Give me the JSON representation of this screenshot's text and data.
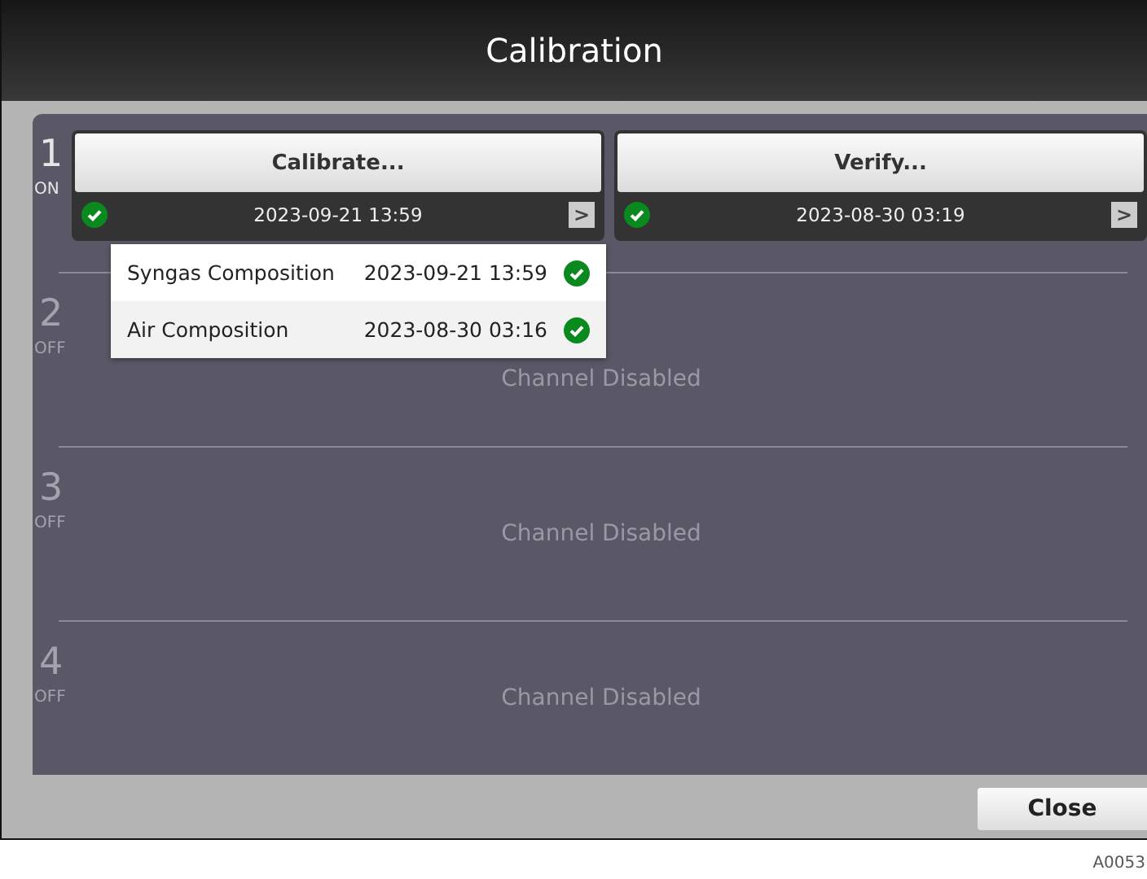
{
  "window": {
    "title": "Calibration"
  },
  "channels": [
    {
      "kind": "active",
      "number": "1",
      "status": "ON",
      "actions": [
        {
          "label": "Calibrate...",
          "date": "2023-09-21 13:59",
          "more": ">",
          "details": [
            {
              "name": "Syngas Composition",
              "date": "2023-09-21 13:59"
            },
            {
              "name": "Air Composition",
              "date": "2023-08-30 03:16"
            }
          ]
        },
        {
          "label": "Verify...",
          "date": "2023-08-30 03:19",
          "more": ">"
        }
      ]
    },
    {
      "kind": "disabled",
      "number": "2",
      "status": "OFF",
      "message": "Channel Disabled"
    },
    {
      "kind": "disabled",
      "number": "3",
      "status": "OFF",
      "message": "Channel Disabled"
    },
    {
      "kind": "disabled",
      "number": "4",
      "status": "OFF",
      "message": "Channel Disabled"
    }
  ],
  "buttons": [
    "Close"
  ],
  "figure_label": "A0053"
}
